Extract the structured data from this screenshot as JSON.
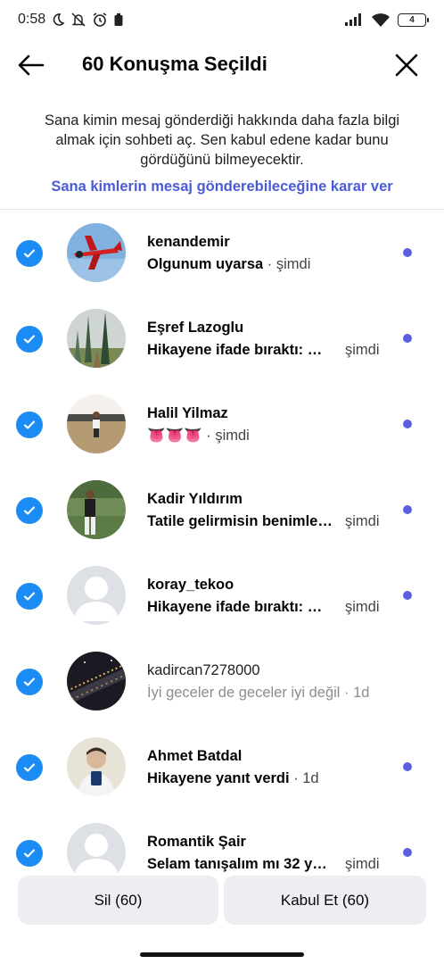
{
  "status_bar": {
    "time": "0:58",
    "battery": "4"
  },
  "header": {
    "title": "60 Konuşma Seçildi"
  },
  "info": {
    "text": "Sana kimin mesaj gönderdiği hakkında daha fazla bilgi almak için sohbeti aç. Sen kabul edene kadar bunu gördüğünü bilmeyecektir.",
    "link": "Sana kimlerin mesaj gönderebileceğine karar ver"
  },
  "conversations": [
    {
      "name": "kenandemir",
      "preview": "Olgunum uyarsa",
      "time": "şimdi",
      "separator": " · ",
      "unread": true,
      "selected": true
    },
    {
      "name": "Eşref Lazoglu",
      "preview": "Hikayene ifade bıraktı: …",
      "time": "şimdi",
      "separator": "",
      "unread": true,
      "selected": true
    },
    {
      "name": "Halil Yilmaz",
      "preview": "👅👅👅",
      "time": "şimdi",
      "separator": " · ",
      "unread": true,
      "selected": true
    },
    {
      "name": "Kadir Yıldırım",
      "preview": "Tatile gelirmisin benimle…",
      "time": "şimdi",
      "separator": "",
      "unread": true,
      "selected": true
    },
    {
      "name": "koray_tekoo",
      "preview": "Hikayene ifade bıraktı: …",
      "time": "şimdi",
      "separator": "",
      "unread": true,
      "selected": true
    },
    {
      "name": "kadircan7278000",
      "preview": "İyi geceler de geceler iyi değil",
      "time": "1d",
      "separator": " · ",
      "unread": false,
      "selected": true
    },
    {
      "name": "Ahmet Batdal",
      "preview": "Hikayene yanıt verdi",
      "time": "1d",
      "separator": " · ",
      "unread": true,
      "selected": true
    },
    {
      "name": "Romantik Şair",
      "preview": "Selam tanışalım mı 32 y…",
      "time": "şimdi",
      "separator": "",
      "unread": true,
      "selected": true
    }
  ],
  "actions": {
    "delete_label": "Sil (60)",
    "accept_label": "Kabul Et (60)"
  },
  "colors": {
    "accent": "#1b8bf5",
    "link": "#4a5bd8",
    "unread_dot": "#5a5fe0",
    "button_bg": "#eceef1"
  }
}
